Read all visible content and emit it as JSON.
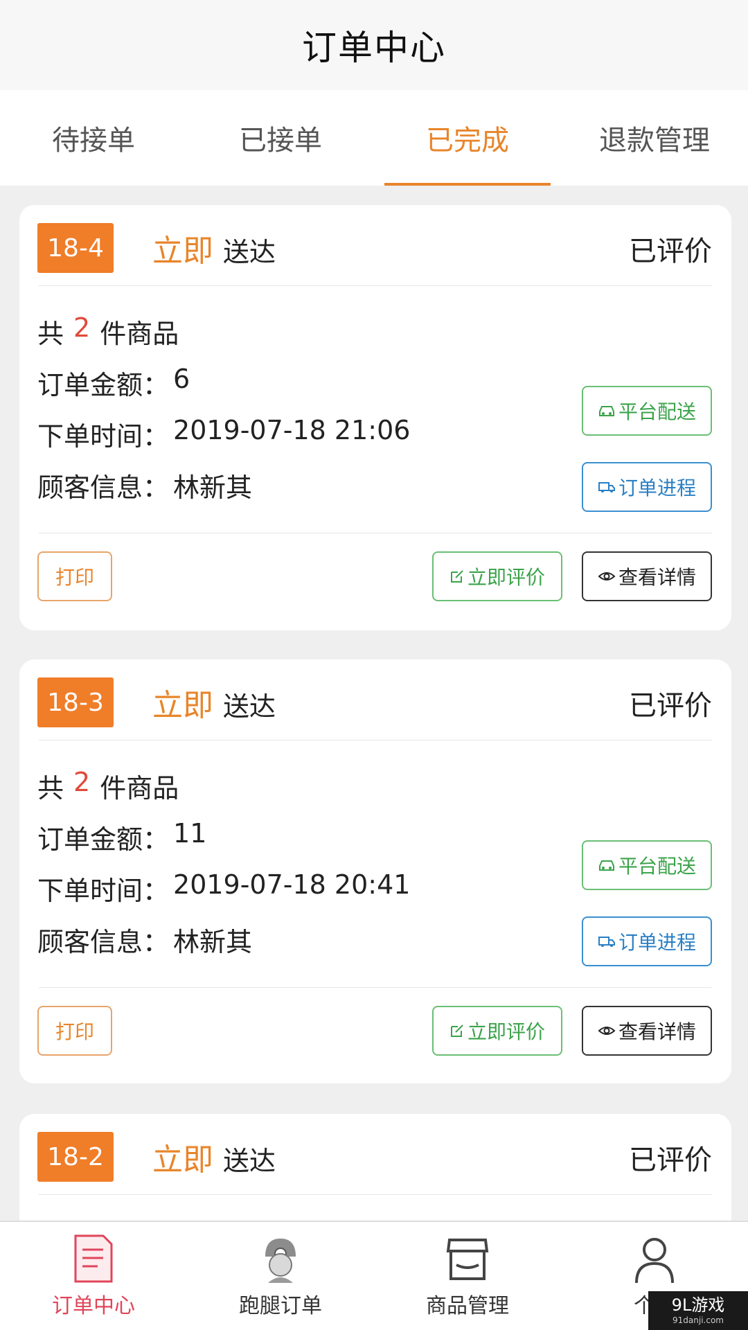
{
  "header": {
    "title": "订单中心"
  },
  "tabs": [
    {
      "label": "待接单",
      "active": false
    },
    {
      "label": "已接单",
      "active": false
    },
    {
      "label": "已完成",
      "active": true
    },
    {
      "label": "退款管理",
      "active": false
    }
  ],
  "orders": [
    {
      "badge": "18-4",
      "delivery_highlight": "立即",
      "delivery_text": "送达",
      "status": "已评价",
      "count_prefix": "共",
      "count": "2",
      "count_suffix": "件商品",
      "amount_label": "订单金额：",
      "amount": "6",
      "time_label": "下单时间：",
      "time": "2019-07-18 21:06",
      "customer_label": "顾客信息：",
      "customer": "林新其",
      "platform_button": "平台配送",
      "progress_button": "订单进程",
      "print_button": "打印",
      "review_button": "立即评价",
      "detail_button": "查看详情"
    },
    {
      "badge": "18-3",
      "delivery_highlight": "立即",
      "delivery_text": "送达",
      "status": "已评价",
      "count_prefix": "共",
      "count": "2",
      "count_suffix": "件商品",
      "amount_label": "订单金额：",
      "amount": "11",
      "time_label": "下单时间：",
      "time": "2019-07-18 20:41",
      "customer_label": "顾客信息：",
      "customer": "林新其",
      "platform_button": "平台配送",
      "progress_button": "订单进程",
      "print_button": "打印",
      "review_button": "立即评价",
      "detail_button": "查看详情"
    },
    {
      "badge": "18-2",
      "delivery_highlight": "立即",
      "delivery_text": "送达",
      "status": "已评价"
    }
  ],
  "bottom_nav": [
    {
      "label": "订单中心",
      "icon": "document-icon",
      "active": true
    },
    {
      "label": "跑腿订单",
      "icon": "courier-avatar-icon",
      "active": false
    },
    {
      "label": "商品管理",
      "icon": "store-icon",
      "active": false
    },
    {
      "label": "个人",
      "icon": "person-icon",
      "active": false
    }
  ],
  "watermark": {
    "text": "9L游戏",
    "sub": "91danji.com"
  },
  "colors": {
    "accent": "#e8852a",
    "badge": "#f07d28",
    "nav_active": "#e0455a",
    "green": "#3aa34a",
    "blue": "#2a7fc4"
  }
}
